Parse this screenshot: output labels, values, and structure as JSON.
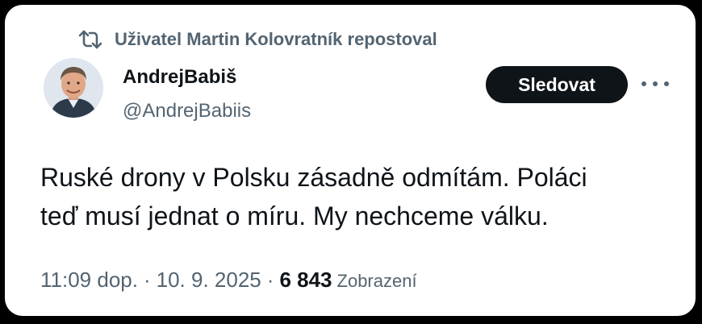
{
  "repost": {
    "text": "Uživatel Martin Kolovratník repostoval",
    "icon": "repost-icon"
  },
  "author": {
    "name": "AndrejBabiš",
    "handle": "@AndrejBabiis"
  },
  "actions": {
    "follow_label": "Sledovat",
    "more_icon": "more-horizontal-icon"
  },
  "tweet": {
    "text_line1": "Ruské drony v Polsku zásadně odmítám. Poláci",
    "text_line2": "teď musí jednat o míru. My nechceme válku."
  },
  "meta": {
    "time": "11:09 dop.",
    "separator": "·",
    "date": "10. 9. 2025",
    "views_count": "6 843",
    "views_label": "Zobrazení"
  },
  "colors": {
    "background": "#000000",
    "card": "#ffffff",
    "primary_text": "#0f1419",
    "secondary_text": "#536471",
    "button_bg": "#0f1419",
    "button_text": "#ffffff"
  }
}
